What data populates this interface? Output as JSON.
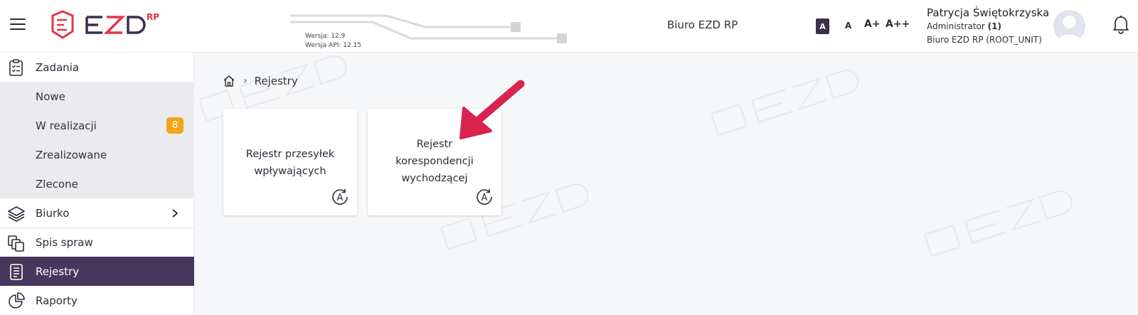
{
  "header": {
    "logo_text": "EZD",
    "logo_suffix": "RP",
    "version": "Wersja: 12.9",
    "api_version": "Wersja API: 12.15",
    "office": "Biuro EZD RP",
    "font_sizes": [
      "A",
      "A",
      "A+",
      "A++"
    ],
    "user": {
      "name": "Patrycja Świętokrzyska",
      "role": "Administrator",
      "role_count": "(1)",
      "unit": "Biuro EZD RP (ROOT_UNIT)"
    }
  },
  "sidebar": {
    "items": [
      {
        "label": "Zadania",
        "icon": "clipboard-icon"
      },
      {
        "label": "Nowe"
      },
      {
        "label": "W realizacji",
        "badge": "8"
      },
      {
        "label": "Zrealizowane"
      },
      {
        "label": "Zlecone"
      },
      {
        "label": "Biurko",
        "icon": "layers-icon"
      },
      {
        "label": "Spis spraw",
        "icon": "documents-icon"
      },
      {
        "label": "Rejestry",
        "icon": "register-icon",
        "active": true
      },
      {
        "label": "Raporty",
        "icon": "pie-chart-icon"
      }
    ]
  },
  "breadcrumb": {
    "current": "Rejestry"
  },
  "cards": [
    {
      "title_lines": [
        "Rejestr przesyłek",
        "wpływających"
      ]
    },
    {
      "title_lines": [
        "Rejestr",
        "korespondencji",
        "wychodzącej"
      ]
    }
  ],
  "colors": {
    "accent": "#46385c",
    "badge": "#f2a619",
    "logo_red": "#e5344a",
    "arrow": "#d8244f"
  }
}
